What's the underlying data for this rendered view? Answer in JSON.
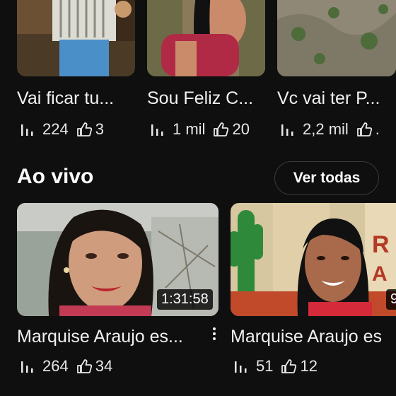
{
  "top_row": [
    {
      "title": "Vai ficar tu...",
      "views": "224",
      "likes": "3"
    },
    {
      "title": "Sou Feliz C...",
      "views": "1 mil",
      "likes": "20"
    },
    {
      "title": "Vc vai ter P...",
      "views": "2,2 mil",
      "likes": "."
    }
  ],
  "live_section": {
    "heading": "Ao vivo",
    "see_all_label": "Ver todas",
    "videos": [
      {
        "title": "Marquise Araujo es...",
        "duration": "1:31:58",
        "views": "264",
        "likes": "34"
      },
      {
        "title": "Marquise Araujo es",
        "duration": "9",
        "views": "51",
        "likes": "12"
      }
    ]
  },
  "icons": {
    "views": "bar-chart-icon",
    "likes": "thumbs-up-icon",
    "more": "more-vert-icon"
  },
  "colors": {
    "background": "#0f0f0f",
    "text": "#f1f1f1",
    "chip_border": "#3a3a3a"
  }
}
